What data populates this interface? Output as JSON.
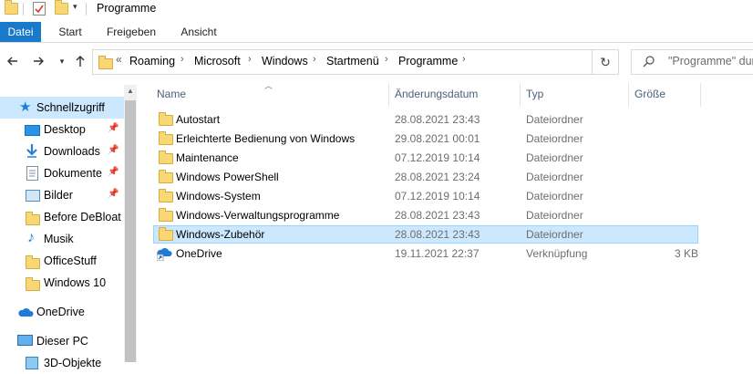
{
  "window": {
    "title": "Programme"
  },
  "ribbon": {
    "tabs": [
      {
        "label": "Datei"
      },
      {
        "label": "Start"
      },
      {
        "label": "Freigeben"
      },
      {
        "label": "Ansicht"
      }
    ]
  },
  "addressbar": {
    "overflow": "«",
    "crumbs": [
      "Roaming",
      "Microsoft",
      "Windows",
      "Startmenü",
      "Programme"
    ]
  },
  "search": {
    "placeholder": "\"Programme\" durchsuchen"
  },
  "nav": {
    "items": [
      {
        "label": "Schnellzugriff",
        "icon": "star-icon",
        "selected": true
      },
      {
        "label": "Desktop",
        "icon": "desktop-icon",
        "pinned": true
      },
      {
        "label": "Downloads",
        "icon": "download-icon",
        "pinned": true
      },
      {
        "label": "Dokumente",
        "icon": "document-icon",
        "pinned": true
      },
      {
        "label": "Bilder",
        "icon": "pictures-icon",
        "pinned": true
      },
      {
        "label": "Before DeBloat",
        "icon": "folder-icon"
      },
      {
        "label": "Musik",
        "icon": "music-icon"
      },
      {
        "label": "OfficeStuff",
        "icon": "folder-icon"
      },
      {
        "label": "Windows 10",
        "icon": "folder-icon"
      },
      {
        "label": "OneDrive",
        "icon": "cloud-icon"
      },
      {
        "label": "Dieser PC",
        "icon": "computer-icon"
      },
      {
        "label": "3D-Objekte",
        "icon": "cube-icon"
      }
    ]
  },
  "table": {
    "columns": {
      "name": "Name",
      "date": "Änderungsdatum",
      "type": "Typ",
      "size": "Größe"
    },
    "rows": [
      {
        "name": "Autostart",
        "date": "28.08.2021 23:43",
        "type": "Dateiordner",
        "size": ""
      },
      {
        "name": "Erleichterte Bedienung von Windows",
        "date": "29.08.2021 00:01",
        "type": "Dateiordner",
        "size": ""
      },
      {
        "name": "Maintenance",
        "date": "07.12.2019 10:14",
        "type": "Dateiordner",
        "size": ""
      },
      {
        "name": "Windows PowerShell",
        "date": "28.08.2021 23:24",
        "type": "Dateiordner",
        "size": ""
      },
      {
        "name": "Windows-System",
        "date": "07.12.2019 10:14",
        "type": "Dateiordner",
        "size": ""
      },
      {
        "name": "Windows-Verwaltungsprogramme",
        "date": "28.08.2021 23:43",
        "type": "Dateiordner",
        "size": ""
      },
      {
        "name": "Windows-Zubehör",
        "date": "28.08.2021 23:43",
        "type": "Dateiordner",
        "size": "",
        "selected": true
      },
      {
        "name": "OneDrive",
        "date": "19.11.2021 22:37",
        "type": "Verknüpfung",
        "size": "3 KB"
      }
    ]
  },
  "colors": {
    "accent": "#1979ca",
    "selection": "#cce8ff",
    "folder": "#f8d775"
  }
}
